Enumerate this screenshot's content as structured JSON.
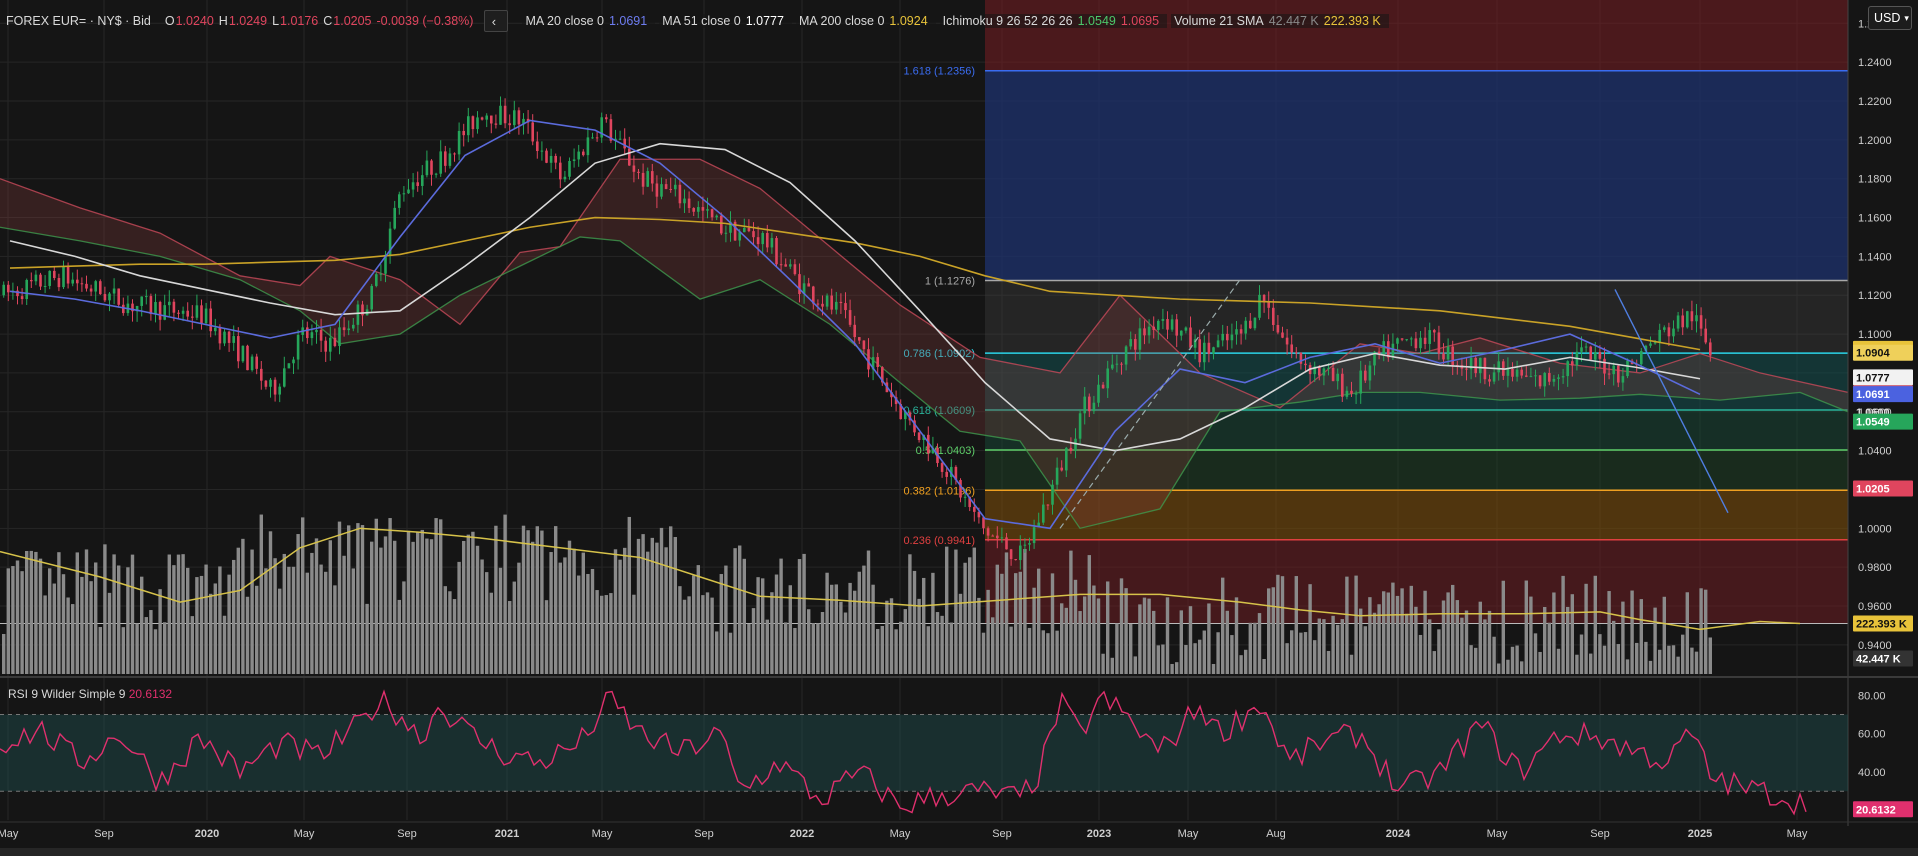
{
  "legend": {
    "symbol": "FOREX EUR= · NY$ · Bid",
    "ohlc": {
      "o_label": "O",
      "o": "1.0240",
      "h_label": "H",
      "h": "1.0249",
      "l_label": "L",
      "l": "1.0176",
      "c_label": "C",
      "c": "1.0205",
      "chg": "-0.0039 (−0.38%)"
    },
    "ma20": {
      "label": "MA 20 close 0",
      "value": "1.0691"
    },
    "ma51": {
      "label": "MA 51 close 0",
      "value": "1.0777"
    },
    "ma200": {
      "label": "MA 200 close 0",
      "value": "1.0924"
    },
    "ichimoku": {
      "label": "Ichimoku 9 26 52 26 26",
      "v1": "1.0549",
      "v2": "1.0695"
    },
    "volume": {
      "label": "Volume 21 SMA",
      "v1": "42.447 K",
      "v2": "222.393 K"
    }
  },
  "currency": "USD",
  "rsi_legend": {
    "label": "RSI 9 Wilder Simple 9",
    "value": "20.6132"
  },
  "colors": {
    "up": "#26a65b",
    "down": "#e0455e",
    "ma20": "#5b6bdc",
    "ma51": "#d8d8d8",
    "ma200": "#c9a227",
    "rsi": "#e0306e",
    "vol": "#8a8a8a",
    "volsma": "#d6c24a"
  },
  "chart_data": {
    "type": "candlestick",
    "price_axis": {
      "ylim": [
        0.925,
        1.272
      ],
      "ticks": [
        "0.9400",
        "0.9600",
        "0.9800",
        "1.0000",
        "1.0200",
        "1.0400",
        "1.0600",
        "1.0800",
        "1.1000",
        "1.1200",
        "1.1400",
        "1.1600",
        "1.1800",
        "1.2000",
        "1.2200",
        "1.2400",
        "1.2600"
      ]
    },
    "time_axis": {
      "labels": [
        "May",
        "Sep",
        "2020",
        "May",
        "Sep",
        "2021",
        "May",
        "Sep",
        "2022",
        "May",
        "Sep",
        "2023",
        "May",
        "Aug",
        "2024",
        "May",
        "Sep",
        "2025",
        "May"
      ]
    },
    "rsi_axis": {
      "ylim": [
        15,
        88
      ],
      "ticks": [
        "40.00",
        "60.00",
        "80.00"
      ],
      "levels": [
        30,
        70
      ]
    },
    "fibonacci": [
      {
        "label": "1.618 (1.2356)",
        "value": 1.2356,
        "color": "#3a6cf0"
      },
      {
        "label": "1 (1.1276)",
        "value": 1.1276,
        "color": "#a8a8a8"
      },
      {
        "label": "0.786 (1.0902)",
        "value": 1.0902,
        "color": "#2ad4e8"
      },
      {
        "label": "0.618 (1.0609)",
        "value": 1.0609,
        "color": "#2ab39a"
      },
      {
        "label": "0.5 (1.0403)",
        "value": 1.0403,
        "color": "#5fcf6a"
      },
      {
        "label": "0.382 (1.0196)",
        "value": 1.0196,
        "color": "#f0a020"
      },
      {
        "label": "0.236 (0.9941)",
        "value": 0.9941,
        "color": "#e04040"
      }
    ],
    "badges": [
      {
        "text": "1.0924",
        "value": 1.0924,
        "bg": "#e8c33a",
        "fg": "#111"
      },
      {
        "text": "1.0904",
        "value": 1.0904,
        "bg": "#efd05a",
        "fg": "#111"
      },
      {
        "text": "1.0777",
        "value": 1.0777,
        "bg": "#f2f2f2",
        "fg": "#111"
      },
      {
        "text": "1.0695",
        "value": 1.0695,
        "bg": "#e0455e",
        "fg": "#fff"
      },
      {
        "text": "1.0691",
        "value": 1.0691,
        "bg": "#4b62e0",
        "fg": "#fff"
      },
      {
        "text": "1.0600",
        "value": 1.06,
        "bg": "none",
        "fg": "#ddd"
      },
      {
        "text": "1.0549",
        "value": 1.0549,
        "bg": "#26a65b",
        "fg": "#fff"
      },
      {
        "text": "1.0205",
        "value": 1.0205,
        "bg": "#e0455e",
        "fg": "#fff"
      },
      {
        "text": "222.393 K",
        "value": 0.951,
        "bg": "#e8c33a",
        "fg": "#111"
      },
      {
        "text": "42.447 K",
        "value": 0.933,
        "bg": "#333",
        "fg": "#fff"
      }
    ],
    "rsi_badge": "20.6132",
    "series": [
      {
        "name": "MA 200 close 0",
        "points": [
          1.134,
          1.135,
          1.136,
          1.136,
          1.137,
          1.138,
          1.141,
          1.148,
          1.155,
          1.16,
          1.159,
          1.157,
          1.152,
          1.147,
          1.14,
          1.13,
          1.122,
          1.12,
          1.118,
          1.117,
          1.116,
          1.114,
          1.112,
          1.108,
          1.104,
          1.098,
          1.092
        ]
      },
      {
        "name": "MA 51 close 0",
        "points": [
          1.148,
          1.14,
          1.13,
          1.123,
          1.116,
          1.11,
          1.112,
          1.135,
          1.16,
          1.188,
          1.198,
          1.195,
          1.178,
          1.148,
          1.112,
          1.075,
          1.046,
          1.04,
          1.046,
          1.062,
          1.082,
          1.09,
          1.084,
          1.082,
          1.088,
          1.083,
          1.077
        ]
      },
      {
        "name": "MA 20 close 0",
        "points": [
          1.122,
          1.118,
          1.112,
          1.105,
          1.098,
          1.105,
          1.15,
          1.192,
          1.21,
          1.205,
          1.188,
          1.16,
          1.128,
          1.095,
          1.05,
          1.005,
          1.0,
          1.05,
          1.082,
          1.075,
          1.088,
          1.095,
          1.085,
          1.092,
          1.1,
          1.085,
          1.069
        ]
      }
    ]
  }
}
